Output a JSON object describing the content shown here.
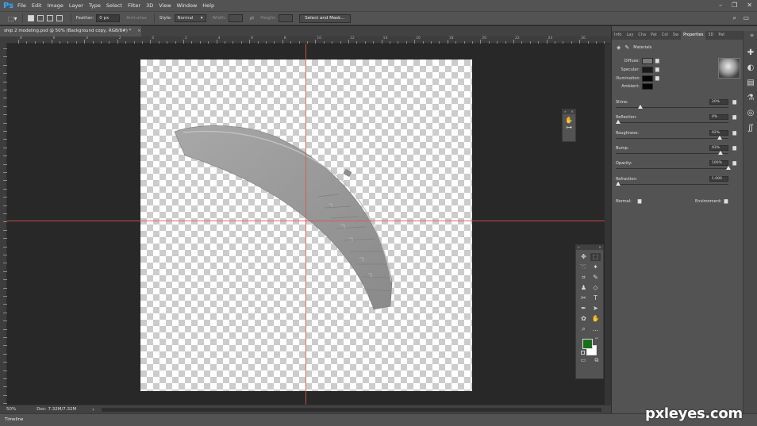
{
  "app": {
    "logo": "Ps",
    "menu": [
      "File",
      "Edit",
      "Image",
      "Layer",
      "Type",
      "Select",
      "Filter",
      "3D",
      "View",
      "Window",
      "Help"
    ]
  },
  "options": {
    "feather_label": "Feather:",
    "feather_value": "0 px",
    "antialias_label": "Anti-alias",
    "style_label": "Style:",
    "style_value": "Normal",
    "width_label": "Width:",
    "height_label": "Height:",
    "select_mask_label": "Select and Mask..."
  },
  "document": {
    "tab_title": "ship 2 modeling.psd @ 50% (Background copy, RGB/8#) *",
    "close_glyph": "×"
  },
  "rulers": {
    "top_labels": [
      "8",
      "6",
      "4",
      "2",
      "0",
      "2",
      "4",
      "6",
      "8",
      "10",
      "12",
      "14",
      "16",
      "18",
      "20",
      "22",
      "24",
      "26",
      "28"
    ]
  },
  "status": {
    "zoom": "50%",
    "doc": "Doc: 7.32M/7.32M"
  },
  "timeline": {
    "label": "Timeline"
  },
  "properties": {
    "tabs": [
      "Info",
      "Lay",
      "Cha",
      "Pat",
      "Col",
      "Sw",
      "Properties",
      "3D",
      "Pat"
    ],
    "active_tab": "Properties",
    "section": "Materials",
    "channels": [
      {
        "label": "Diffuse:",
        "color": "#7a7a7a"
      },
      {
        "label": "Specular:",
        "color": "#1a1a1a"
      },
      {
        "label": "Illumination:",
        "color": "#050505"
      },
      {
        "label": "Ambient:",
        "color": "#050505"
      }
    ],
    "sliders": [
      {
        "label": "Shine:",
        "value": "20%",
        "level": 0.2
      },
      {
        "label": "Reflection:",
        "value": "0%",
        "level": 0.0
      },
      {
        "label": "Roughness:",
        "value": "92%",
        "level": 0.92
      },
      {
        "label": "Bump:",
        "value": "93%",
        "level": 0.93
      },
      {
        "label": "Opacity:",
        "value": "100%",
        "level": 1.0
      }
    ],
    "refraction": {
      "label": "Refraction:",
      "value": "1.000"
    },
    "normal_label": "Normal:",
    "environment_label": "Environment:"
  },
  "tools": {
    "foreground_color": "#1a6e1a",
    "background_color": "#ffffff"
  },
  "watermark": "pxleyes.com"
}
